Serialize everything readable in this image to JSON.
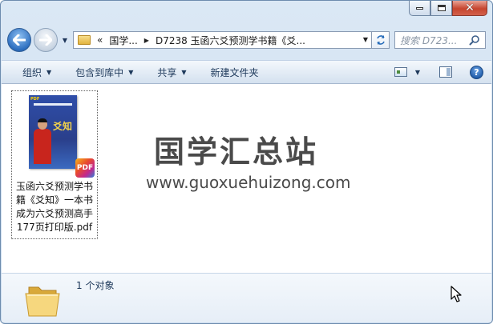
{
  "window": {
    "caption": {
      "minimize": "minimize",
      "maximize": "maximize",
      "close": "✕"
    }
  },
  "navigation": {
    "address": {
      "overflow": "«",
      "crumbs": [
        "国学...",
        "D7238 玉函六爻预测学书籍《爻..."
      ]
    },
    "search_placeholder": "搜索 D723..."
  },
  "toolbar": {
    "organize": "组织",
    "include_in_library": "包含到库中",
    "share": "共享",
    "new_folder": "新建文件夹",
    "help": "?"
  },
  "content": {
    "files": [
      {
        "name": "玉函六爻预测学书籍《爻知》一本书成为六爻预测高手177页打印版.pdf",
        "name_lines": [
          "玉函六爻预测学书",
          "籍《爻知》一本书",
          "成为六爻预测高手",
          "177页打印版.pdf"
        ],
        "badge": "PDF",
        "thumbnail_title": "爻知",
        "thumbnail_corner": "PDF"
      }
    ]
  },
  "watermark": {
    "title": "国学汇总站",
    "url": "www.guoxuehuizong.com"
  },
  "details": {
    "item_count": "1 个对象"
  },
  "colors": {
    "toolbar_text": "#1e395b",
    "window_frame": "#c9dbee",
    "close_button": "#c6452f",
    "watermark": "#4a4a4a"
  }
}
